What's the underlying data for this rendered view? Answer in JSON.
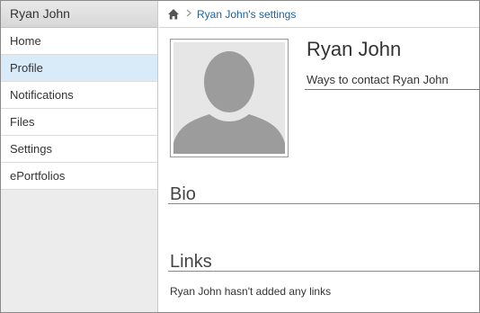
{
  "sidebar": {
    "title": "Ryan John",
    "items": [
      {
        "label": "Home",
        "active": false
      },
      {
        "label": "Profile",
        "active": true
      },
      {
        "label": "Notifications",
        "active": false
      },
      {
        "label": "Files",
        "active": false
      },
      {
        "label": "Settings",
        "active": false
      },
      {
        "label": "ePortfolios",
        "active": false
      }
    ]
  },
  "breadcrumb": {
    "home_icon": "home-icon",
    "separator_icon": "chevron-right-icon",
    "current": "Ryan John's settings"
  },
  "profile": {
    "name": "Ryan John",
    "contact_link": "Ways to contact Ryan John",
    "avatar_icon": "default-avatar-silhouette"
  },
  "sections": {
    "bio_heading": "Bio",
    "links_heading": "Links",
    "links_empty_text": "Ryan John hasn't added any links"
  },
  "colors": {
    "link": "#1d5f9b",
    "active_nav": "#d9ebf8",
    "sidebar_bg": "#ececec"
  }
}
